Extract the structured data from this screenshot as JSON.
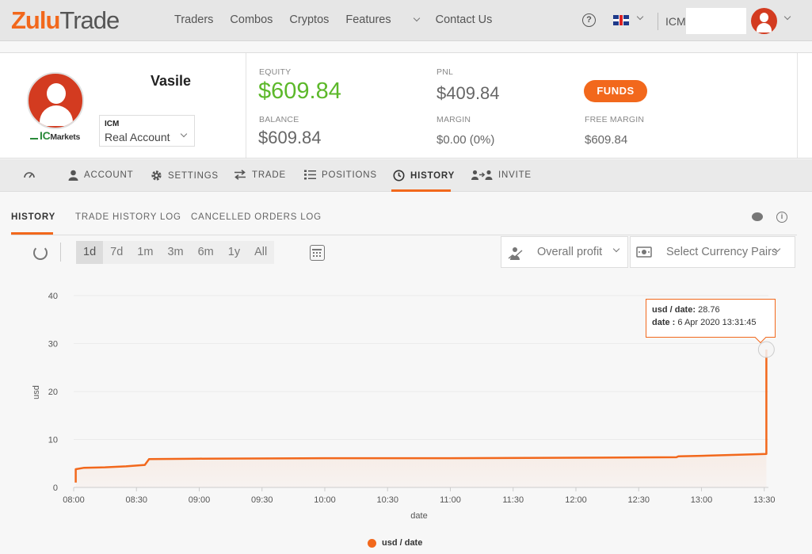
{
  "header": {
    "logo": {
      "part1": "Zulu",
      "part2": "Trade"
    },
    "nav": [
      {
        "label": "Traders"
      },
      {
        "label": "Combos"
      },
      {
        "label": "Cryptos"
      },
      {
        "label": "Features"
      },
      {
        "label": "Contact Us"
      }
    ],
    "help_glyph": "?",
    "user_label": "ICM",
    "icons": {
      "help": "help-circle-icon",
      "flag": "uk-flag-icon",
      "avatar": "user-avatar-icon"
    }
  },
  "account": {
    "name": "Vasile",
    "broker_logo": {
      "ic": "IC",
      "markets": "Markets"
    },
    "selector": {
      "broker": "ICM",
      "type": "Real Account"
    },
    "stats": {
      "equity_label": "EQUITY",
      "equity_value": "$609.84",
      "balance_label": "BALANCE",
      "balance_value": "$609.84",
      "pnl_label": "PNL",
      "pnl_value": "$409.84",
      "margin_label": "MARGIN",
      "margin_value": "$0.00 (0%)",
      "free_margin_label": "FREE MARGIN",
      "free_margin_value": "$609.84"
    },
    "funds_button": "FUNDS",
    "colors": {
      "equity": "#5cb82a",
      "accent": "#f2681c"
    }
  },
  "tabs": [
    {
      "label": "",
      "icon": "dashboard-gauge-icon"
    },
    {
      "label": "ACCOUNT",
      "icon": "person-icon"
    },
    {
      "label": "SETTINGS",
      "icon": "gear-icon"
    },
    {
      "label": "TRADE",
      "icon": "swap-arrows-icon"
    },
    {
      "label": "POSITIONS",
      "icon": "list-icon"
    },
    {
      "label": "HISTORY",
      "icon": "clock-icon",
      "active": true
    },
    {
      "label": "INVITE",
      "icon": "invite-users-icon"
    }
  ],
  "subtabs": [
    {
      "label": "HISTORY",
      "active": true
    },
    {
      "label": "TRADE HISTORY LOG"
    },
    {
      "label": "CANCELLED ORDERS LOG"
    }
  ],
  "toolbar": {
    "ranges": [
      "1d",
      "7d",
      "1m",
      "3m",
      "6m",
      "1y",
      "All"
    ],
    "active_range": "1d",
    "profit_dropdown": "Overall profit",
    "currency_dropdown": "Select Currency Pairs"
  },
  "tooltip": {
    "line1_label": "usd / date:",
    "line1_value": "28.76",
    "line2_label": "date :",
    "line2_value": "6 Apr 2020 13:31:45"
  },
  "chart_data": {
    "type": "area",
    "xlabel": "date",
    "ylabel": "usd",
    "ylim": [
      0,
      40
    ],
    "yticks": [
      0,
      10,
      20,
      30,
      40
    ],
    "xticks": [
      "08:00",
      "08:30",
      "09:00",
      "09:30",
      "10:00",
      "10:30",
      "11:00",
      "11:30",
      "12:00",
      "12:30",
      "13:00",
      "13:30"
    ],
    "xlim": [
      "08:00",
      "13:32"
    ],
    "grid": true,
    "legend_position": "bottom-center",
    "series": [
      {
        "name": "usd / date",
        "color": "#f2681c",
        "x": [
          "08:01",
          "08:01",
          "08:05",
          "08:15",
          "08:25",
          "08:34",
          "08:36",
          "09:00",
          "10:00",
          "11:00",
          "12:00",
          "12:48",
          "12:49",
          "13:00",
          "13:31",
          "13:31",
          "13:31"
        ],
        "y": [
          1.0,
          3.8,
          4.1,
          4.2,
          4.4,
          4.7,
          5.9,
          6.0,
          6.1,
          6.1,
          6.2,
          6.3,
          6.5,
          6.6,
          7.0,
          10.0,
          28.76
        ]
      }
    ]
  }
}
